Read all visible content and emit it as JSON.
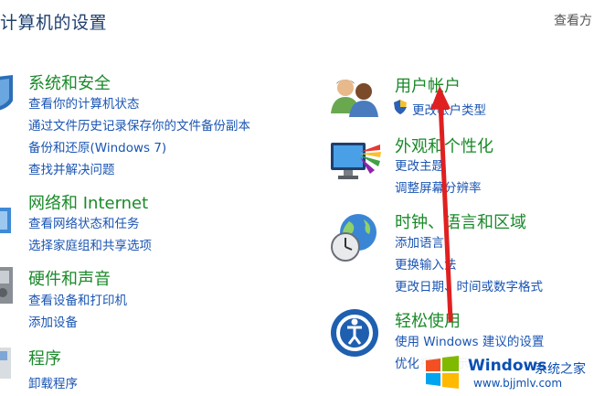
{
  "header": {
    "title": "计算机的设置",
    "view_label": "查看方"
  },
  "left_categories": [
    {
      "name": "系统和安全",
      "links": [
        "查看你的计算机状态",
        "通过文件历史记录保存你的文件备份副本",
        "备份和还原(Windows 7)",
        "查找并解决问题"
      ]
    },
    {
      "name": "网络和 Internet",
      "links": [
        "查看网络状态和任务",
        "选择家庭组和共享选项"
      ]
    },
    {
      "name": "硬件和声音",
      "links": [
        "查看设备和打印机",
        "添加设备"
      ]
    },
    {
      "name": "程序",
      "links": [
        "卸载程序"
      ]
    }
  ],
  "right_categories": [
    {
      "name": "用户帐户",
      "links": [
        "更改帐户类型"
      ]
    },
    {
      "name": "外观和个性化",
      "links": [
        "更改主题",
        "调整屏幕分辨率"
      ]
    },
    {
      "name": "时钟、语言和区域",
      "links": [
        "添加语言",
        "更换输入法",
        "更改日期、时间或数字格式"
      ]
    },
    {
      "name": "轻松使用",
      "links": [
        "使用 Windows 建议的设置",
        "优化视觉显示"
      ]
    }
  ],
  "watermark": {
    "brand": "Windows",
    "cn": "系统之家",
    "url": "www.bjjmlv.com"
  },
  "colors": {
    "category": "#1a8a2a",
    "link": "#1a55b3",
    "arrow": "#e02020"
  }
}
